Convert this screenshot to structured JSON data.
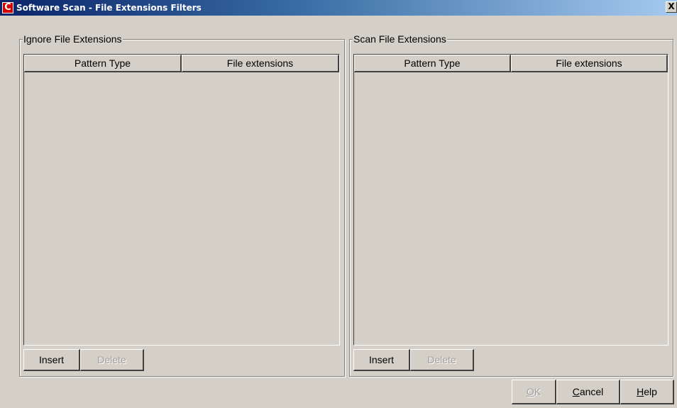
{
  "window": {
    "title": "Software Scan - File Extensions Filters",
    "icon_letter": "C",
    "close_glyph": "X"
  },
  "ignore_group": {
    "legend": "Ignore File Extensions",
    "columns": [
      "Pattern Type",
      "File extensions"
    ],
    "rows": [],
    "insert_label": "Insert",
    "delete_label": "Delete"
  },
  "scan_group": {
    "legend": "Scan File Extensions",
    "columns": [
      "Pattern Type",
      "File extensions"
    ],
    "rows": [],
    "insert_label": "Insert",
    "delete_label": "Delete"
  },
  "dialog_buttons": {
    "ok_mnemonic": "O",
    "ok_rest": "K",
    "cancel_mnemonic": "C",
    "cancel_rest": "ancel",
    "help_mnemonic": "H",
    "help_rest": "elp"
  },
  "colors": {
    "face": "#d4d0c8",
    "title_start": "#0a246a",
    "title_end": "#a6caf0",
    "disabled_text": "#a0a0a0"
  }
}
